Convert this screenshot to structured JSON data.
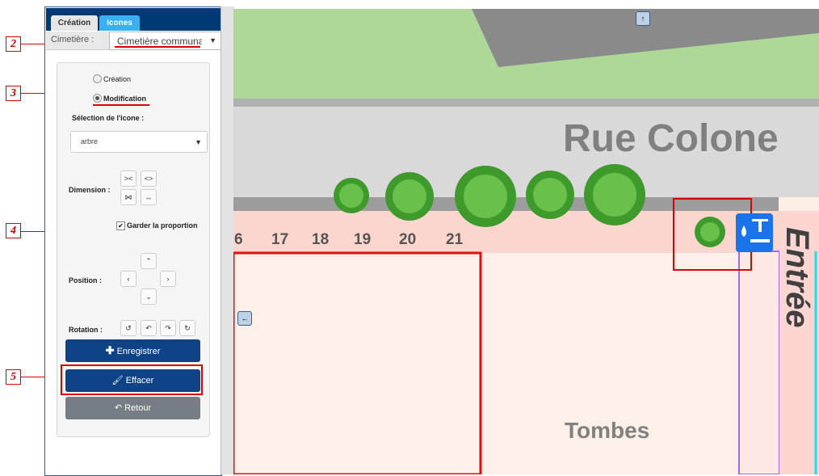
{
  "callouts": [
    "2",
    "3",
    "4",
    "5"
  ],
  "tabs": {
    "creation": "Création",
    "icones": "Icones"
  },
  "cimetiere": {
    "label": "Cimetière :",
    "value": "Cimetière communa"
  },
  "mode": {
    "creation": "Création",
    "modification": "Modification",
    "selected": "Modification"
  },
  "icon_selection": {
    "label": "Sélection de l'icone :",
    "value": "arbre"
  },
  "dimension": {
    "label": "Dimension :"
  },
  "keep_ratio": {
    "label": "Garder la proportion",
    "checked": true
  },
  "position": {
    "label": "Position :"
  },
  "rotation": {
    "label": "Rotation :"
  },
  "buttons": {
    "save": "Enregistrer",
    "erase": "Effacer",
    "back": "Retour"
  },
  "map": {
    "street": "Rue Colone",
    "entrance": "Entrée",
    "area": "Tombes",
    "plot_numbers": [
      "6",
      "17",
      "18",
      "19",
      "20",
      "21"
    ]
  },
  "colors": {
    "primary": "#0f4386",
    "tab_active": "#3ab0f0",
    "grass": "#aed898",
    "road": "#d9d9d9",
    "plot": "#fdeee6",
    "plot_border": "#e01010",
    "callout": "#d00000"
  }
}
